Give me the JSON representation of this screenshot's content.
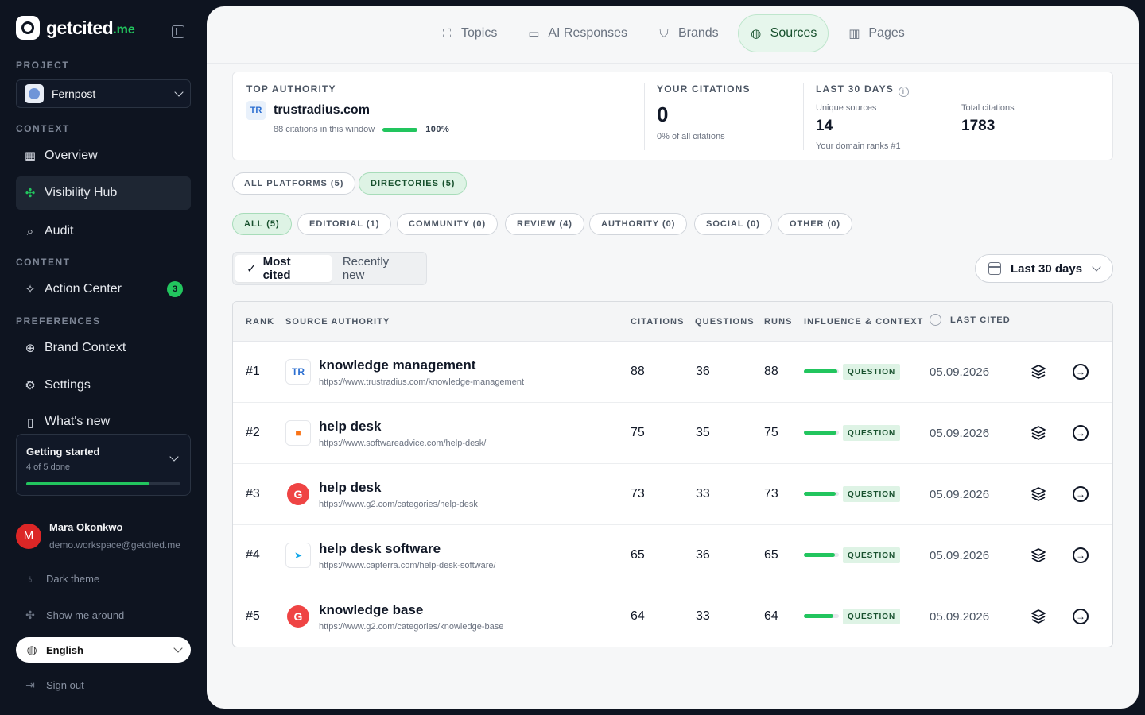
{
  "brand": {
    "name": "getcited",
    "tld": ".me"
  },
  "sidebar": {
    "project_label": "PROJECT",
    "project_name": "Fernpost",
    "context_label": "CONTEXT",
    "content_label": "CONTENT",
    "preferences_label": "PREFERENCES",
    "items": {
      "overview": "Overview",
      "visibility": "Visibility Hub",
      "audit": "Audit",
      "action_center": "Action Center",
      "action_center_badge": "3",
      "brand_context": "Brand Context",
      "settings": "Settings",
      "whats_new": "What's new"
    },
    "getting_started": {
      "title": "Getting started",
      "progress_text": "4 of 5 done",
      "progress": 0.8
    },
    "user": {
      "initial": "M",
      "name": "Mara Okonkwo",
      "email": "demo.workspace@getcited.me"
    },
    "dark_theme": "Dark theme",
    "show_around": "Show me around",
    "language": "English",
    "sign_out": "Sign out"
  },
  "tabs": {
    "topics": "Topics",
    "ai_responses": "AI Responses",
    "brands": "Brands",
    "sources": "Sources",
    "pages": "Pages"
  },
  "kpi": {
    "top_authority_label": "TOP AUTHORITY",
    "top_domain": "trustradius.com",
    "top_meta": "88 citations in this window",
    "top_pct": "100%",
    "your_citations_label": "YOUR CITATIONS",
    "your_citations": "0",
    "your_citations_sub": "0% of all citations",
    "last30_label": "LAST 30 DAYS",
    "unique_sources_label": "Unique sources",
    "unique_sources": "14",
    "domain_rank": "Your domain ranks #1",
    "total_citations_label": "Total citations",
    "total_citations": "1783"
  },
  "filters": {
    "platform": [
      "ALL PLATFORMS (5)",
      "DIRECTORIES (5)"
    ],
    "types": [
      "ALL (5)",
      "EDITORIAL (1)",
      "COMMUNITY (0)",
      "REVIEW (4)",
      "AUTHORITY (0)",
      "SOCIAL (0)",
      "OTHER (0)"
    ]
  },
  "sort": {
    "most_cited": "Most cited",
    "recently_new": "Recently new"
  },
  "date_range": "Last 30 days",
  "table": {
    "headers": {
      "rank": "RANK",
      "source": "SOURCE AUTHORITY",
      "citations": "CITATIONS",
      "questions": "QUESTIONS",
      "runs": "RUNS",
      "influence": "INFLUENCE & CONTEXT",
      "last_cited": "LAST CITED"
    },
    "rows": [
      {
        "rank": "#1",
        "title": "knowledge management",
        "url": "https://www.trustradius.com/knowledge-management",
        "citations": "88",
        "questions": "36",
        "runs": "88",
        "influence": 0.95,
        "context": "QUESTION",
        "date": "05.09.2026",
        "icon": "trustradius-icon",
        "icon_color": "#2c6fd1"
      },
      {
        "rank": "#2",
        "title": "help desk",
        "url": "https://www.softwareadvice.com/help-desk/",
        "citations": "75",
        "questions": "35",
        "runs": "75",
        "influence": 0.93,
        "context": "QUESTION",
        "date": "05.09.2026",
        "icon": "softwareadvice-icon",
        "icon_color": "#f97316"
      },
      {
        "rank": "#3",
        "title": "help desk",
        "url": "https://www.g2.com/categories/help-desk",
        "citations": "73",
        "questions": "33",
        "runs": "73",
        "influence": 0.9,
        "context": "QUESTION",
        "date": "05.09.2026",
        "icon": "g2-icon",
        "icon_color": "#ef4444"
      },
      {
        "rank": "#4",
        "title": "help desk software",
        "url": "https://www.capterra.com/help-desk-software/",
        "citations": "65",
        "questions": "36",
        "runs": "65",
        "influence": 0.88,
        "context": "QUESTION",
        "date": "05.09.2026",
        "icon": "capterra-icon",
        "icon_color": "#0ea5e9"
      },
      {
        "rank": "#5",
        "title": "knowledge base",
        "url": "https://www.g2.com/categories/knowledge-base",
        "citations": "64",
        "questions": "33",
        "runs": "64",
        "influence": 0.85,
        "context": "QUESTION",
        "date": "05.09.2026",
        "icon": "g2-icon",
        "icon_color": "#ef4444"
      }
    ]
  }
}
